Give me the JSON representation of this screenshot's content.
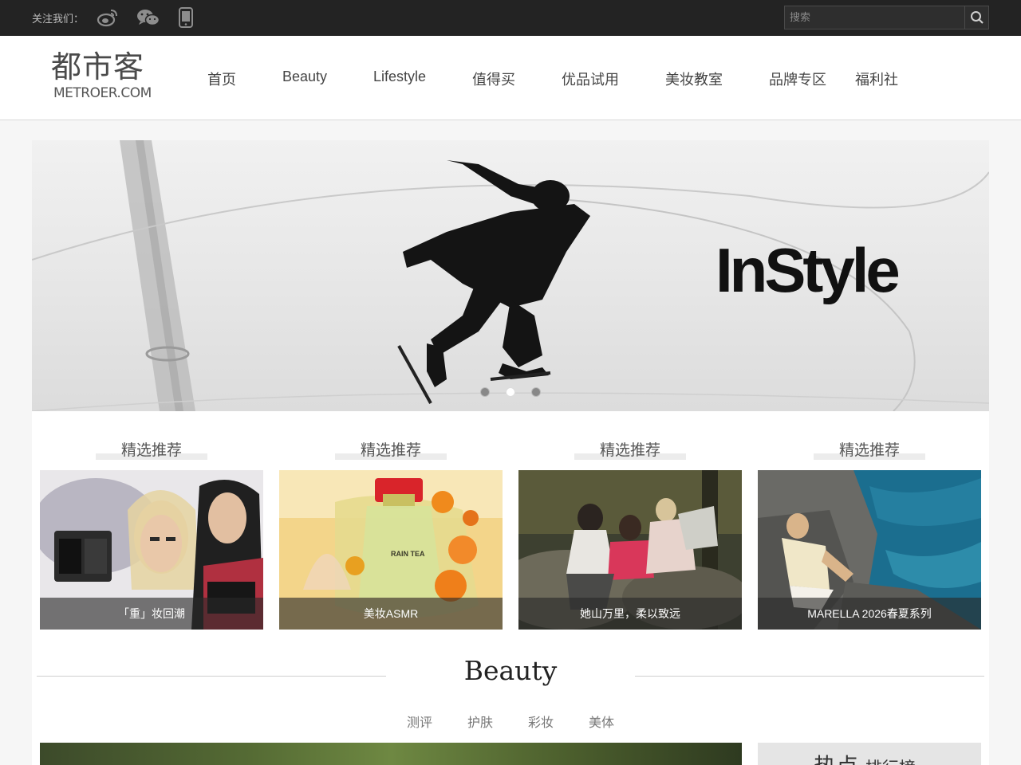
{
  "topbar": {
    "follow_label": "关注我们：",
    "social_icons": [
      "weibo-icon",
      "wechat-icon",
      "mobile-icon"
    ],
    "search_placeholder": "搜索"
  },
  "header": {
    "logo_cn": "都市客",
    "logo_en": "METROER.COM",
    "nav": [
      "首页",
      "Beauty",
      "Lifestyle",
      "值得买",
      "优品试用",
      "美妆教室",
      "品牌专区",
      "福利社"
    ]
  },
  "banner": {
    "brand": "InStyle",
    "active_slide": 2,
    "slide_count": 3
  },
  "featured": [
    {
      "title": "精选推荐",
      "caption": "「重」妆回潮"
    },
    {
      "title": "精选推荐",
      "caption": "美妆ASMR"
    },
    {
      "title": "精选推荐",
      "caption": "她山万里，柔以致远"
    },
    {
      "title": "精选推荐",
      "caption": "MARELLA 2026春夏系列"
    }
  ],
  "section": {
    "title": "Beauty",
    "subtabs": [
      "测评",
      "护肤",
      "彩妆",
      "美体"
    ]
  },
  "rank": {
    "title_big": "热点",
    "title_small": "排行榜"
  },
  "colors": {
    "topbar_bg": "#232323",
    "header_bg": "#ffffff",
    "page_bg": "#f6f6f6"
  }
}
